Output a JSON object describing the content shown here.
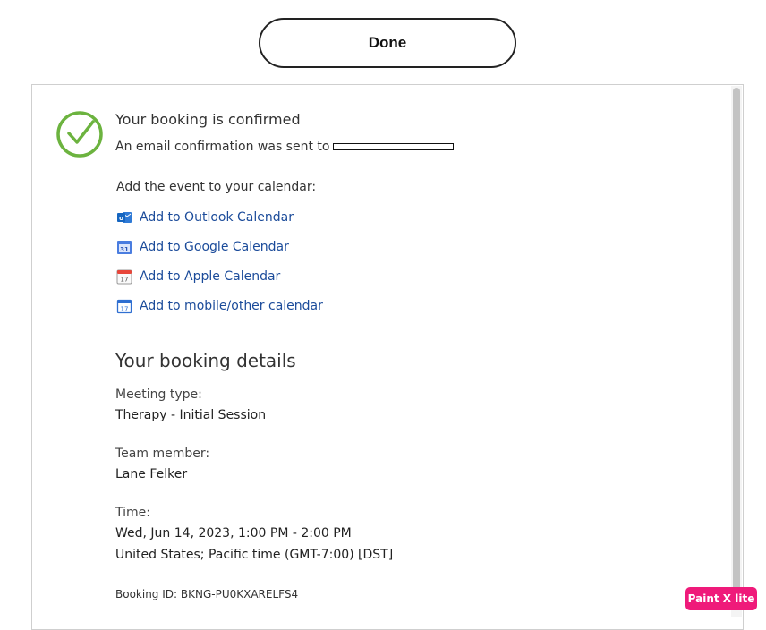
{
  "header": {
    "done_label": "Done"
  },
  "confirmation": {
    "title": "Your booking is confirmed",
    "email_prefix": "An email confirmation was sent to"
  },
  "calendar": {
    "heading": "Add the event to your calendar:",
    "links": [
      {
        "label": "Add to Outlook Calendar",
        "icon": "outlook-icon"
      },
      {
        "label": "Add to Google Calendar",
        "icon": "google-calendar-icon"
      },
      {
        "label": "Add to Apple Calendar",
        "icon": "apple-calendar-icon"
      },
      {
        "label": "Add to mobile/other calendar",
        "icon": "calendar-icon"
      }
    ]
  },
  "details": {
    "heading": "Your booking details",
    "meeting_type_label": "Meeting type:",
    "meeting_type_value": "Therapy - Initial Session",
    "team_member_label": "Team member:",
    "team_member_value": "Lane Felker",
    "time_label": "Time:",
    "time_value": "Wed, Jun 14, 2023, 1:00 PM - 2:00 PM",
    "timezone_value": "United States; Pacific time (GMT-7:00) [DST]",
    "booking_id": "Booking ID: BKNG-PU0KXARELFS4"
  },
  "watermark": {
    "text": "Paint X lite"
  },
  "colors": {
    "check": "#6cb33f",
    "link": "#1b4b9a",
    "badge": "#ef1a7a"
  }
}
